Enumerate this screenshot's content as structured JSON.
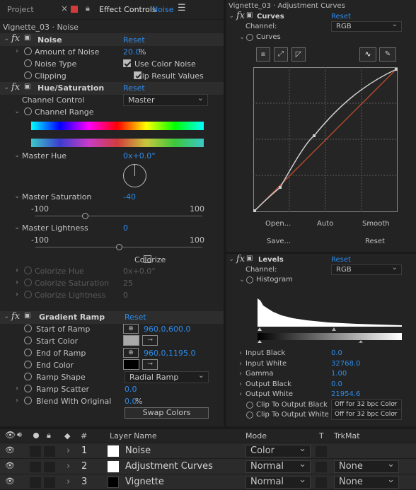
{
  "left_tabs": {
    "project": "Project",
    "effect_controls": "Effect Controls",
    "effect_controls_layer": "Noise"
  },
  "left_breadcrumb": "Vignette_03 · Noise",
  "noise": {
    "name": "Noise",
    "reset": "Reset",
    "amount_label": "Amount of Noise",
    "amount_value": "20.0",
    "amount_unit": "%",
    "type_label": "Noise Type",
    "type_check": "Use Color Noise",
    "clip_label": "Clipping",
    "clip_check": "Clip Result Values"
  },
  "hue": {
    "name": "Hue/Saturation",
    "reset": "Reset",
    "channel_control_label": "Channel Control",
    "channel_control_value": "Master",
    "channel_range_label": "Channel Range",
    "master_hue_label": "Master Hue",
    "master_hue_value": "0x+0.0°",
    "master_sat_label": "Master Saturation",
    "master_sat_value": "-40",
    "sat_min": "-100",
    "sat_max": "100",
    "sat_fraction": 0.3,
    "master_light_label": "Master Lightness",
    "master_light_value": "0",
    "light_min": "-100",
    "light_max": "100",
    "light_fraction": 0.5,
    "colorize": "Colorize",
    "colorize_hue_label": "Colorize Hue",
    "colorize_hue_value": "0x+0.0°",
    "colorize_sat_label": "Colorize Saturation",
    "colorize_sat_value": "25",
    "colorize_light_label": "Colorize Lightness",
    "colorize_light_value": "0"
  },
  "ramp": {
    "name": "Gradient Ramp",
    "reset": "Reset",
    "start_label": "Start of Ramp",
    "start_value": "960.0,600.0",
    "start_color_label": "Start Color",
    "end_label": "End of Ramp",
    "end_value": "960.0,1195.0",
    "end_color_label": "End Color",
    "shape_label": "Ramp Shape",
    "shape_value": "Radial Ramp",
    "scatter_label": "Ramp Scatter",
    "scatter_value": "0.0",
    "blend_label": "Blend With Original",
    "blend_value": "0.0",
    "blend_unit": "%",
    "swap": "Swap Colors"
  },
  "right_breadcrumb": "Vignette_03 · Adjustment Curves",
  "curves": {
    "name": "Curves",
    "reset": "Reset",
    "channel_label": "Channel:",
    "channel_value": "RGB",
    "sub_label": "Curves",
    "open": "Open...",
    "auto": "Auto",
    "smooth": "Smooth",
    "save": "Save...",
    "reset_btn": "Reset"
  },
  "levels": {
    "name": "Levels",
    "reset": "Reset",
    "channel_label": "Channel:",
    "channel_value": "RGB",
    "histogram": "Histogram",
    "input_black_label": "Input Black",
    "input_black_value": "0.0",
    "input_white_label": "Input White",
    "input_white_value": "32768.0",
    "gamma_label": "Gamma",
    "gamma_value": "1.00",
    "output_black_label": "Output Black",
    "output_black_value": "0.0",
    "output_white_label": "Output White",
    "output_white_value": "21954.6",
    "clip_black_label": "Clip To Output Black",
    "clip_black_value": "Off for 32 bpc Color",
    "clip_white_label": "Clip To Output White",
    "clip_white_value": "Off for 32 bpc Color"
  },
  "timeline": {
    "col_hash": "#",
    "col_layer": "Layer Name",
    "col_mode": "Mode",
    "col_t": "T",
    "col_trkmat": "TrkMat",
    "layers": [
      {
        "num": "1",
        "name": "Noise",
        "mode": "Color",
        "trkmat": "",
        "color": "#ffffff"
      },
      {
        "num": "2",
        "name": "Adjustment Curves",
        "mode": "Normal",
        "trkmat": "None",
        "color": "#ffffff"
      },
      {
        "num": "3",
        "name": "Vignette",
        "mode": "Normal",
        "trkmat": "None",
        "color": "#000000"
      }
    ]
  },
  "colors": {
    "accent": "#2d8ceb",
    "start_color": "#a9a9a9",
    "end_color": "#000000"
  }
}
